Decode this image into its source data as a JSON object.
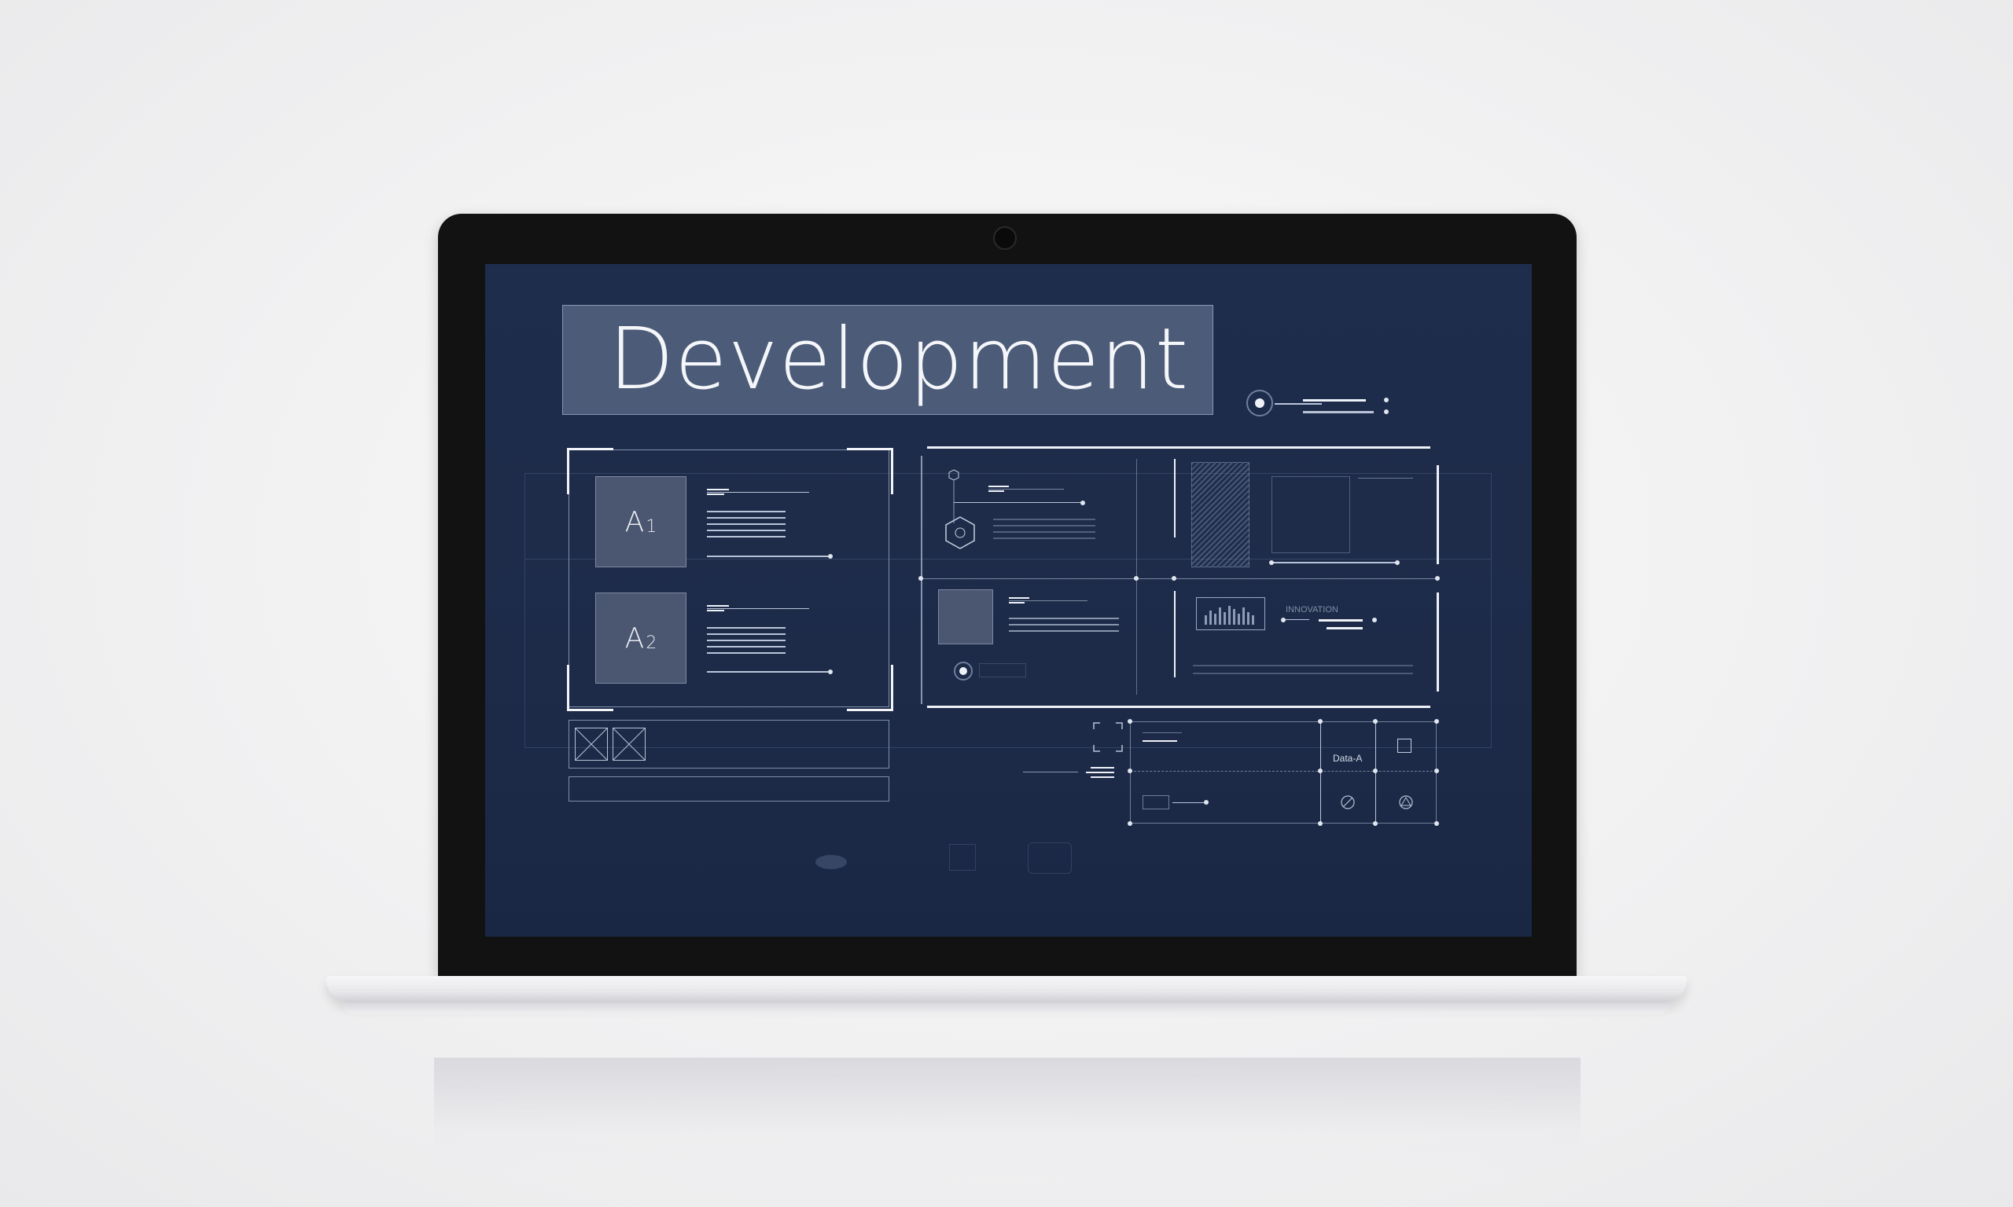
{
  "screen": {
    "title": "Development",
    "cards": [
      {
        "letter": "A",
        "index": "1"
      },
      {
        "letter": "A",
        "index": "2"
      }
    ],
    "labels": {
      "innovation": "INNOVATION",
      "data_a": "Data-A"
    }
  },
  "colors": {
    "screen_bg": "#1f2d4c",
    "title_box": "#4c5b78",
    "bezel": "#121212",
    "line": "#b9c4d8"
  }
}
